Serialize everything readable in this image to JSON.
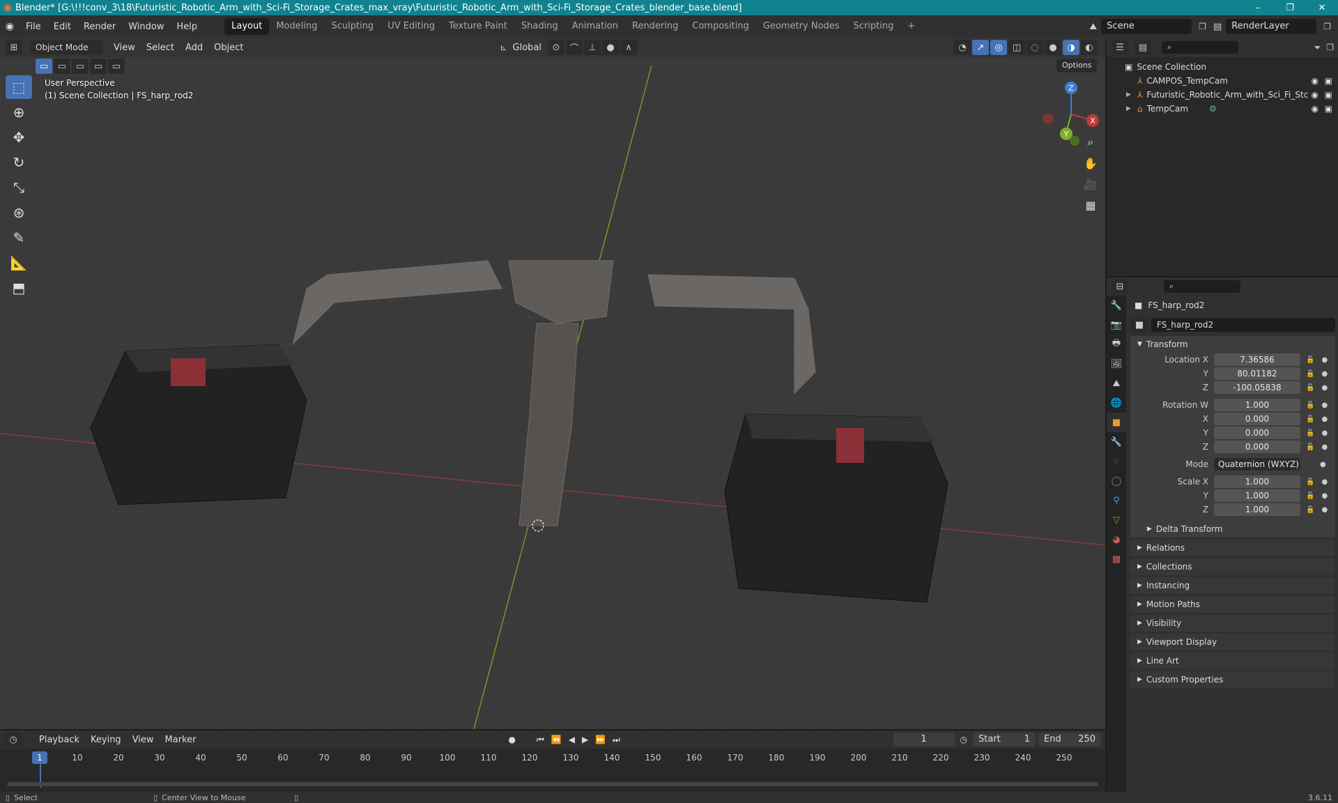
{
  "titlebar": {
    "title": "Blender* [G:\\!!!conv_3\\18\\Futuristic_Robotic_Arm_with_Sci-Fi_Storage_Crates_max_vray\\Futuristic_Robotic_Arm_with_Sci-Fi_Storage_Crates_blender_base.blend]",
    "min": "–",
    "max": "❐",
    "close": "✕"
  },
  "menus": [
    "File",
    "Edit",
    "Render",
    "Window",
    "Help"
  ],
  "workspaces": [
    "Layout",
    "Modeling",
    "Sculpting",
    "UV Editing",
    "Texture Paint",
    "Shading",
    "Animation",
    "Rendering",
    "Compositing",
    "Geometry Nodes",
    "Scripting",
    "+"
  ],
  "scene": {
    "name": "Scene",
    "layer": "RenderLayer"
  },
  "viewport": {
    "mode": "Object Mode",
    "menu": [
      "View",
      "Select",
      "Add",
      "Object"
    ],
    "orientation": "Global",
    "options": "Options",
    "info_line1": "User Perspective",
    "info_line2": "(1) Scene Collection | FS_harp_rod2",
    "gizmo": {
      "z": "Z",
      "x": "X",
      "y": "Y"
    }
  },
  "outliner": {
    "root": "Scene Collection",
    "items": [
      "CAMPOS_TempCam",
      "Futuristic_Robotic_Arm_with_Sci_Fi_Stc",
      "TempCam"
    ]
  },
  "properties": {
    "object_name": "FS_harp_rod2",
    "data_name": "FS_harp_rod2",
    "transform_label": "Transform",
    "rows": [
      {
        "label": "Location X",
        "value": "7.36586"
      },
      {
        "label": "Y",
        "value": "80.01182"
      },
      {
        "label": "Z",
        "value": "-100.05838"
      },
      {
        "label": "Rotation W",
        "value": "1.000"
      },
      {
        "label": "X",
        "value": "0.000"
      },
      {
        "label": "Y",
        "value": "0.000"
      },
      {
        "label": "Z",
        "value": "0.000"
      }
    ],
    "mode_label": "Mode",
    "mode_value": "Quaternion (WXYZ)",
    "scale_rows": [
      {
        "label": "Scale X",
        "value": "1.000"
      },
      {
        "label": "Y",
        "value": "1.000"
      },
      {
        "label": "Z",
        "value": "1.000"
      }
    ],
    "delta": "Delta Transform",
    "sections": [
      "Relations",
      "Collections",
      "Instancing",
      "Motion Paths",
      "Visibility",
      "Viewport Display",
      "Line Art",
      "Custom Properties"
    ]
  },
  "timeline": {
    "menu": [
      "Playback",
      "Keying",
      "View",
      "Marker"
    ],
    "current": "1",
    "start_label": "Start",
    "start": "1",
    "end_label": "End",
    "end": "250",
    "ticks": [
      "1",
      "10",
      "20",
      "30",
      "40",
      "50",
      "60",
      "70",
      "80",
      "90",
      "100",
      "110",
      "120",
      "130",
      "140",
      "150",
      "160",
      "170",
      "180",
      "190",
      "200",
      "210",
      "220",
      "230",
      "240",
      "250"
    ]
  },
  "status": {
    "select": "Select",
    "center": "Center View to Mouse",
    "version": "3.6.11"
  },
  "colors": {
    "accent": "#4772b3",
    "title": "#10838f",
    "x_axis": "#c0393b",
    "y_axis": "#7fae2f",
    "z_axis": "#3d7fd1"
  }
}
